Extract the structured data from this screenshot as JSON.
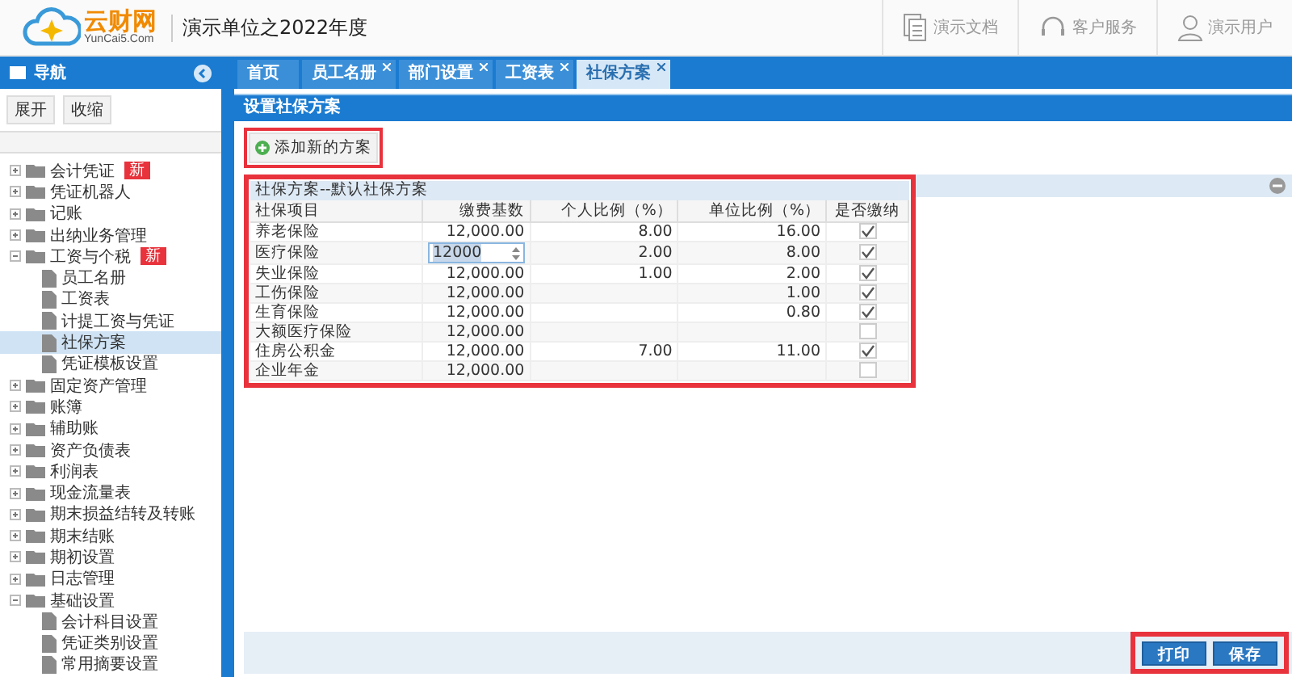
{
  "header": {
    "logo_text": "云财网",
    "logo_sub": "YunCai5.Com",
    "company": "演示单位之2022年度",
    "actions": [
      {
        "label": "演示文档",
        "kind": "doc"
      },
      {
        "label": "客户服务",
        "kind": "service"
      },
      {
        "label": "演示用户",
        "kind": "user"
      }
    ]
  },
  "sidebar": {
    "title": "导航",
    "buttons": [
      "展开",
      "收缩"
    ],
    "items": [
      {
        "label": "会计凭证",
        "badge": "新",
        "expanded": false,
        "selected": false
      },
      {
        "label": "凭证机器人",
        "expanded": false,
        "selected": false
      },
      {
        "label": "记账",
        "expanded": false,
        "selected": false
      },
      {
        "label": "出纳业务管理",
        "expanded": false,
        "selected": false
      },
      {
        "label": "工资与个税",
        "badge": "新",
        "expanded": true,
        "selected": false,
        "children": [
          {
            "label": "员工名册",
            "selected": false
          },
          {
            "label": "工资表",
            "selected": false
          },
          {
            "label": "计提工资与凭证",
            "selected": false
          },
          {
            "label": "社保方案",
            "selected": true
          },
          {
            "label": "凭证模板设置",
            "selected": false
          }
        ]
      },
      {
        "label": "固定资产管理",
        "expanded": false,
        "selected": false
      },
      {
        "label": "账簿",
        "expanded": false,
        "selected": false
      },
      {
        "label": "辅助账",
        "expanded": false,
        "selected": false
      },
      {
        "label": "资产负债表",
        "expanded": false,
        "selected": false
      },
      {
        "label": "利润表",
        "expanded": false,
        "selected": false
      },
      {
        "label": "现金流量表",
        "expanded": false,
        "selected": false
      },
      {
        "label": "期末损益结转及转账",
        "expanded": false,
        "selected": false
      },
      {
        "label": "期末结账",
        "expanded": false,
        "selected": false
      },
      {
        "label": "期初设置",
        "expanded": false,
        "selected": false
      },
      {
        "label": "日志管理",
        "expanded": false,
        "selected": false
      },
      {
        "label": "基础设置",
        "expanded": true,
        "selected": false,
        "children": [
          {
            "label": "会计科目设置",
            "selected": false
          },
          {
            "label": "凭证类别设置",
            "selected": false
          },
          {
            "label": "常用摘要设置",
            "selected": false
          }
        ]
      }
    ]
  },
  "tabs": [
    {
      "label": "首页",
      "closable": false,
      "selected": false
    },
    {
      "label": "员工名册",
      "closable": true,
      "selected": false
    },
    {
      "label": "部门设置",
      "closable": true,
      "selected": false
    },
    {
      "label": "工资表",
      "closable": true,
      "selected": false
    },
    {
      "label": "社保方案",
      "closable": true,
      "selected": true
    }
  ],
  "page_title": "设置社保方案",
  "add_button": "添加新的方案",
  "table": {
    "title": "社保方案--默认社保方案",
    "columns": [
      "社保项目",
      "缴费基数",
      "个人比例（%）",
      "单位比例（%）",
      "是否缴纳"
    ],
    "rows": [
      {
        "name": "养老保险",
        "base": "12,000.00",
        "personal": "8.00",
        "company": "16.00",
        "checked": true,
        "editing": false
      },
      {
        "name": "医疗保险",
        "base": "12000",
        "personal": "2.00",
        "company": "8.00",
        "checked": true,
        "editing": true
      },
      {
        "name": "失业保险",
        "base": "12,000.00",
        "personal": "1.00",
        "company": "2.00",
        "checked": true,
        "editing": false
      },
      {
        "name": "工伤保险",
        "base": "12,000.00",
        "company": "1.00",
        "checked": true,
        "editing": false
      },
      {
        "name": "生育保险",
        "base": "12,000.00",
        "company": "0.80",
        "checked": true,
        "editing": false
      },
      {
        "name": "大额医疗保险",
        "base": "12,000.00",
        "checked": false,
        "editing": false
      },
      {
        "name": "住房公积金",
        "base": "12,000.00",
        "personal": "7.00",
        "company": "11.00",
        "checked": true,
        "editing": false
      },
      {
        "name": "企业年金",
        "base": "12,000.00",
        "checked": false,
        "editing": false
      }
    ]
  },
  "footer_buttons": [
    "打印",
    "保存"
  ]
}
